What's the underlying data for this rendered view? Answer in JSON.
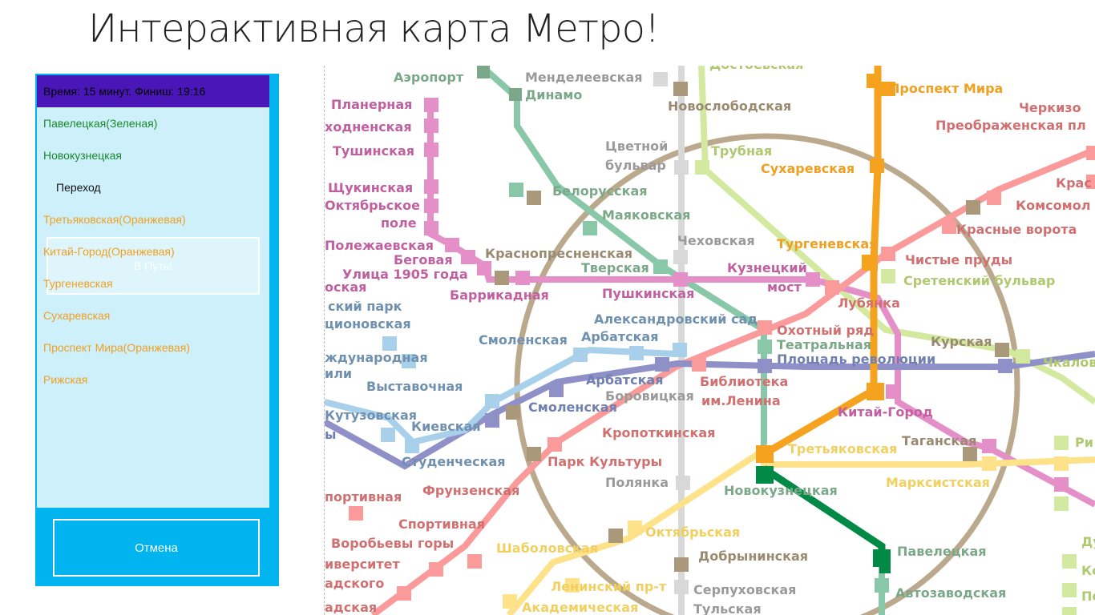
{
  "app": {
    "title": "Интерактивная карта Метро!"
  },
  "route_panel": {
    "header": "Время: 15 минут. Финиш: 19:16",
    "items": [
      {
        "label": "Павелецкая(Зеленая)",
        "color": "#1a8a2a",
        "kind": "station"
      },
      {
        "label": "Новокузнецкая",
        "color": "#1a8a2a",
        "kind": "station"
      },
      {
        "label": "Переход",
        "color": "#111111",
        "kind": "transfer"
      },
      {
        "label": "Третьяковская(Оранжевая)",
        "color": "#f0a020",
        "kind": "station"
      },
      {
        "label": "Китай-Город(Оранжевая)",
        "color": "#f0a020",
        "kind": "station"
      },
      {
        "label": "Тургеневская",
        "color": "#f0a020",
        "kind": "station"
      },
      {
        "label": "Сухаревская",
        "color": "#f0a020",
        "kind": "station"
      },
      {
        "label": "Проспект Мира(Оранжевая)",
        "color": "#f0a020",
        "kind": "station"
      },
      {
        "label": "Рижская",
        "color": "#f0a020",
        "kind": "station"
      }
    ],
    "go_label": "В Путь!",
    "cancel_label": "Отмена"
  },
  "colors": {
    "accent": "#00b4f0",
    "header": "#4a16b8",
    "route_orange": "#f5a21e",
    "route_green": "#008a45"
  },
  "map": {
    "stations": [
      {
        "label": "Аэропорт",
        "color": "#7aa888"
      },
      {
        "label": "Менделеевская",
        "color": "#9a9a9a"
      },
      {
        "label": "Динамо",
        "color": "#7aa888"
      },
      {
        "label": "Новослободская",
        "color": "#9a8a70"
      },
      {
        "label": "Достоевская",
        "color": "#b0c870"
      },
      {
        "label": "Проспект Мира",
        "color": "#f0a020"
      },
      {
        "label": "Черкизо",
        "color": "#d07070"
      },
      {
        "label": "Преображенская пл",
        "color": "#d07070"
      },
      {
        "label": "Планерная",
        "color": "#c060a0"
      },
      {
        "label": "ходненская",
        "color": "#c060a0"
      },
      {
        "label": "Тушинская",
        "color": "#c060a0"
      },
      {
        "label": "Цветной",
        "color": "#9a9a9a"
      },
      {
        "label": "бульвар",
        "color": "#9a9a9a"
      },
      {
        "label": "Трубная",
        "color": "#b0c870"
      },
      {
        "label": "Сухаревская",
        "color": "#f0a020"
      },
      {
        "label": "Щукинская",
        "color": "#c060a0"
      },
      {
        "label": "Октябрьское",
        "color": "#c060a0"
      },
      {
        "label": "поле",
        "color": "#c060a0"
      },
      {
        "label": "Белорусская",
        "color": "#7aa888"
      },
      {
        "label": "Маяковская",
        "color": "#7aa888"
      },
      {
        "label": "Крас",
        "color": "#d07070"
      },
      {
        "label": "Комсомол",
        "color": "#d07070"
      },
      {
        "label": "Красные ворота",
        "color": "#d07070"
      },
      {
        "label": "Полежаевская",
        "color": "#c060a0"
      },
      {
        "label": "Беговая",
        "color": "#c060a0"
      },
      {
        "label": "Улица 1905 года",
        "color": "#c060a0"
      },
      {
        "label": "Краснопресненская",
        "color": "#9a8a70"
      },
      {
        "label": "Чеховская",
        "color": "#9a9a9a"
      },
      {
        "label": "Тургеневская",
        "color": "#f0a020"
      },
      {
        "label": "Чистые пруды",
        "color": "#d07070"
      },
      {
        "label": "Тверская",
        "color": "#7aa888"
      },
      {
        "label": "Кузнецкий",
        "color": "#c060a0"
      },
      {
        "label": "мост",
        "color": "#c060a0"
      },
      {
        "label": "Сретенский бульвар",
        "color": "#b0c870"
      },
      {
        "label": "Баррикадная",
        "color": "#c060a0"
      },
      {
        "label": "Пушкинская",
        "color": "#c060a0"
      },
      {
        "label": "Лубянка",
        "color": "#d07070"
      },
      {
        "label": "оская",
        "color": "#c060a0"
      },
      {
        "label": "ский парк",
        "color": "#7090b0"
      },
      {
        "label": "ционовская",
        "color": "#7090b0"
      },
      {
        "label": "Александровский сад",
        "color": "#7090b0"
      },
      {
        "label": "Охотный ряд",
        "color": "#d07070"
      },
      {
        "label": "Театральная",
        "color": "#7aa888"
      },
      {
        "label": "Площадь революции",
        "color": "#7080b0"
      },
      {
        "label": "Курская",
        "color": "#9a8a70"
      },
      {
        "label": "Смоленская",
        "color": "#7090b0"
      },
      {
        "label": "Арбатская",
        "color": "#7090b0"
      },
      {
        "label": "ждународная",
        "color": "#7090b0"
      },
      {
        "label": "или",
        "color": "#7090b0"
      },
      {
        "label": "Арбатская",
        "color": "#7080b0"
      },
      {
        "label": "Боровицкая",
        "color": "#9a9a9a"
      },
      {
        "label": "Библиотека",
        "color": "#d07070"
      },
      {
        "label": "им.Ленина",
        "color": "#d07070"
      },
      {
        "label": "Чкалов",
        "color": "#b0c870"
      },
      {
        "label": "Выставочная",
        "color": "#7090b0"
      },
      {
        "label": "Кутузовская",
        "color": "#7090b0"
      },
      {
        "label": "ы",
        "color": "#7080b0"
      },
      {
        "label": "Киевская",
        "color": "#7090b0"
      },
      {
        "label": "Смоленская",
        "color": "#7080b0"
      },
      {
        "label": "Кропоткинская",
        "color": "#d07070"
      },
      {
        "label": "Китай-Город",
        "color": "#c060a0"
      },
      {
        "label": "Таганская",
        "color": "#9a8a70"
      },
      {
        "label": "Ри",
        "color": "#b0c870"
      },
      {
        "label": "Третьяковская",
        "color": "#f0d060"
      },
      {
        "label": "Студенческая",
        "color": "#7090b0"
      },
      {
        "label": "Парк Культуры",
        "color": "#d07070"
      },
      {
        "label": "Марксистская",
        "color": "#f0d060"
      },
      {
        "label": "Новокузнецкая",
        "color": "#7aa888"
      },
      {
        "label": "Полянка",
        "color": "#9a9a9a"
      },
      {
        "label": "портивная",
        "color": "#d07070"
      },
      {
        "label": "Фрунзенская",
        "color": "#d07070"
      },
      {
        "label": "Спортивная",
        "color": "#d07070"
      },
      {
        "label": "Октябрьская",
        "color": "#f0d060"
      },
      {
        "label": "Ду",
        "color": "#b0c870"
      },
      {
        "label": "Павелецкая",
        "color": "#7aa888"
      },
      {
        "label": "Воробьевы горы",
        "color": "#d07070"
      },
      {
        "label": "Шаболовская",
        "color": "#f0d060"
      },
      {
        "label": "Ко",
        "color": "#b0c870"
      },
      {
        "label": "иверситет",
        "color": "#d07070"
      },
      {
        "label": "Добрынинская",
        "color": "#9a8a70"
      },
      {
        "label": "адского",
        "color": "#d07070"
      },
      {
        "label": "Ленинский пр-т",
        "color": "#f0d060"
      },
      {
        "label": "Серпуховская",
        "color": "#9a9a9a"
      },
      {
        "label": "Автозаводская",
        "color": "#7aa888"
      },
      {
        "label": "Пе",
        "color": "#b0c870"
      },
      {
        "label": "адская",
        "color": "#d07070"
      },
      {
        "label": "Академическая",
        "color": "#f0d060"
      },
      {
        "label": "Тульская",
        "color": "#9a9a9a"
      }
    ]
  }
}
